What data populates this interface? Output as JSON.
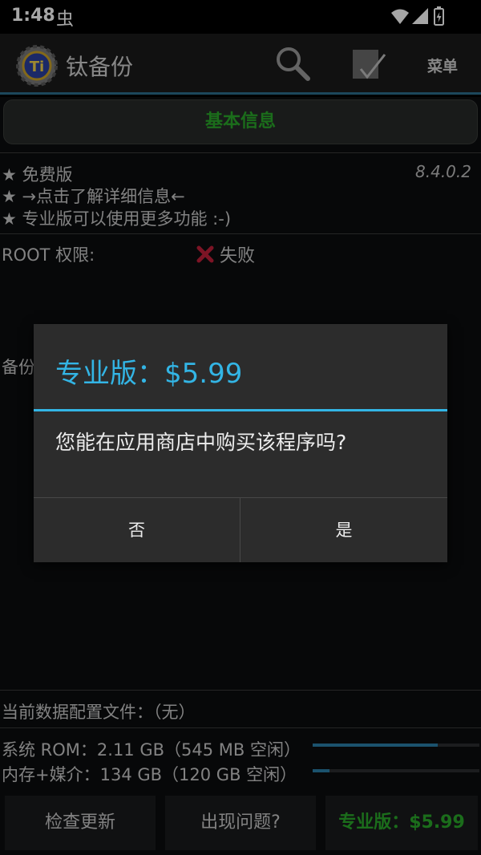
{
  "status_bar": {
    "time": "1:48",
    "notification_glyph": "虫"
  },
  "action_bar": {
    "title": "钛备份",
    "menu_label": "菜单"
  },
  "tab": {
    "label": "基本信息"
  },
  "info": {
    "lines": [
      "★ 免费版",
      "★ →点击了解详细信息←",
      "★ 专业版可以使用更多功能 :-)"
    ],
    "version": "8.4.0.2"
  },
  "root": {
    "label": "ROOT 权限:",
    "status": "失败"
  },
  "backup": {
    "label": "备份"
  },
  "profile": {
    "text": "当前数据配置文件：（无）"
  },
  "storage": [
    {
      "text": "系统 ROM：2.11 GB（545 MB 空闲）",
      "used_fraction": 0.75
    },
    {
      "text": "内存+媒介：134 GB（120 GB 空闲）",
      "used_fraction": 0.1
    }
  ],
  "bottom_buttons": {
    "check_update": "检查更新",
    "problem": "出现问题?",
    "pro": "专业版：$5.99"
  },
  "dialog": {
    "title": "专业版：$5.99",
    "message": "您能在应用商店中购买该程序吗?",
    "negative": "否",
    "positive": "是"
  },
  "colors": {
    "accent": "#33b5e5",
    "pro_green": "#2aa82a",
    "fail_red": "#c0203a"
  }
}
